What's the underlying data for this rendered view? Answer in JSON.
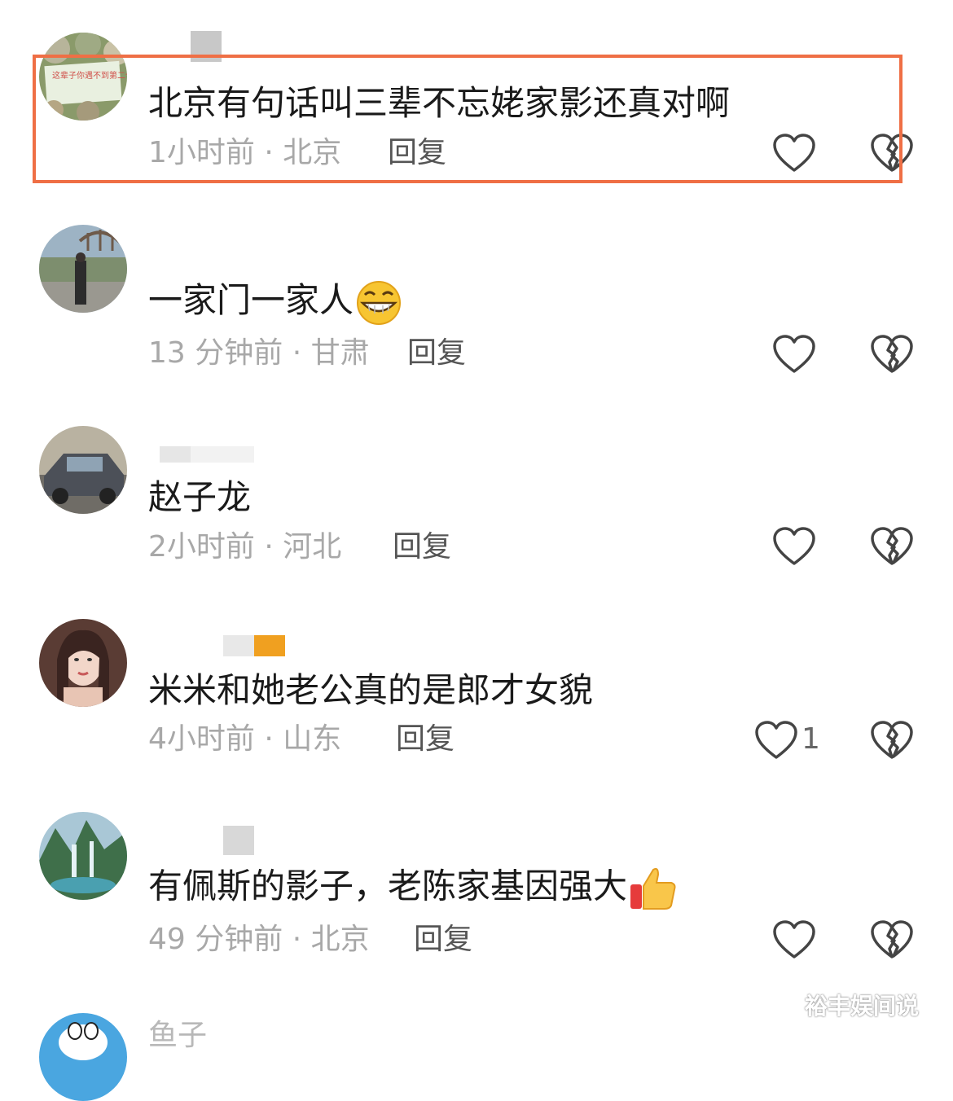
{
  "comments": [
    {
      "text": "北京有句话叫三辈不忘姥家影还真对啊",
      "meta": "1小时前 · 北京",
      "reply": "回复",
      "like_count": ""
    },
    {
      "text": "一家门一家人",
      "meta": "13 分钟前 · 甘肃",
      "reply": "回复",
      "like_count": ""
    },
    {
      "text": "赵子龙",
      "meta": "2小时前 · 河北",
      "reply": "回复",
      "like_count": ""
    },
    {
      "text": "米米和她老公真的是郎才女貌",
      "meta": "4小时前 · 山东",
      "reply": "回复",
      "like_count": "1"
    },
    {
      "text": "有佩斯的影子，老陈家基因强大",
      "meta": "49 分钟前 · 北京",
      "reply": "回复",
      "like_count": ""
    }
  ],
  "partial_next_name": "鱼子",
  "avatar_sign_text": "这辈子你遇不到第二个我",
  "watermark": "裕丰娱间说",
  "colors": {
    "highlight_border": "#ef6f45",
    "meta_gray": "#a8a8a8",
    "text_dark": "#1a1a1a"
  },
  "icons": {
    "like": "heart-outline-icon",
    "dislike": "broken-heart-icon",
    "grin": "grinning-face-emoji",
    "thumbs": "thumbs-up-emoji"
  }
}
